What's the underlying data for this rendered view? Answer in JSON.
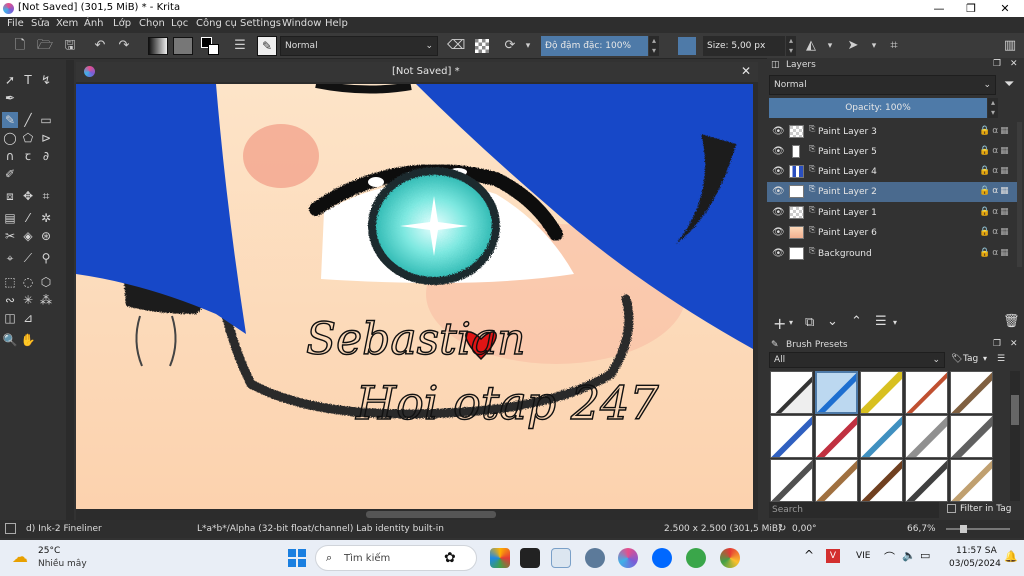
{
  "window": {
    "title": "[Not Saved]  (301,5 MiB)  * - Krita",
    "minimize": "—",
    "maximize": "❐",
    "close": "✕"
  },
  "menu": [
    "File",
    "Sửa",
    "Xem",
    "Ảnh",
    "Lớp",
    "Chọn",
    "Lọc",
    "Công cụ",
    "Settings",
    "Window",
    "Help"
  ],
  "toolbar": {
    "blend_mode": "Normal",
    "opacity": "Độ đậm đặc: 100%",
    "size": "Size: 5,00 px"
  },
  "document": {
    "tab_title": "[Not Saved]  *",
    "close": "✕"
  },
  "layers_panel": {
    "title": "Layers",
    "blend_mode": "Normal",
    "opacity": "Opacity:  100%",
    "layers": [
      {
        "name": "Paint Layer 3",
        "selected": false
      },
      {
        "name": "Paint Layer 5",
        "selected": false
      },
      {
        "name": "Paint Layer 4",
        "selected": false
      },
      {
        "name": "Paint Layer 2",
        "selected": true
      },
      {
        "name": "Paint Layer 1",
        "selected": false
      },
      {
        "name": "Paint Layer 6",
        "selected": false
      },
      {
        "name": "Background",
        "selected": false
      }
    ]
  },
  "brush_presets": {
    "title": "Brush Presets",
    "filter": "All",
    "tag": "Tag",
    "search_placeholder": "Search",
    "filter_in_tag": "Filter in Tag"
  },
  "status": {
    "brush": "d) Ink-2 Fineliner",
    "color_space": "L*a*b*/Alpha (32-bit float/channel)  Lab identity built-in",
    "dimensions": "2.500 x 2.500 (301,5 MiB)",
    "rotation": "0,00°",
    "zoom": "66,7%"
  },
  "taskbar": {
    "weather_temp": "25°C",
    "weather_desc": "Nhiều mây",
    "search_placeholder": "Tìm kiếm",
    "lang": "VIE",
    "time": "11:57 SA",
    "date": "03/05/2024"
  },
  "canvas_text": {
    "line1": "Sebastian",
    "line2": "Hoi otap 247"
  }
}
